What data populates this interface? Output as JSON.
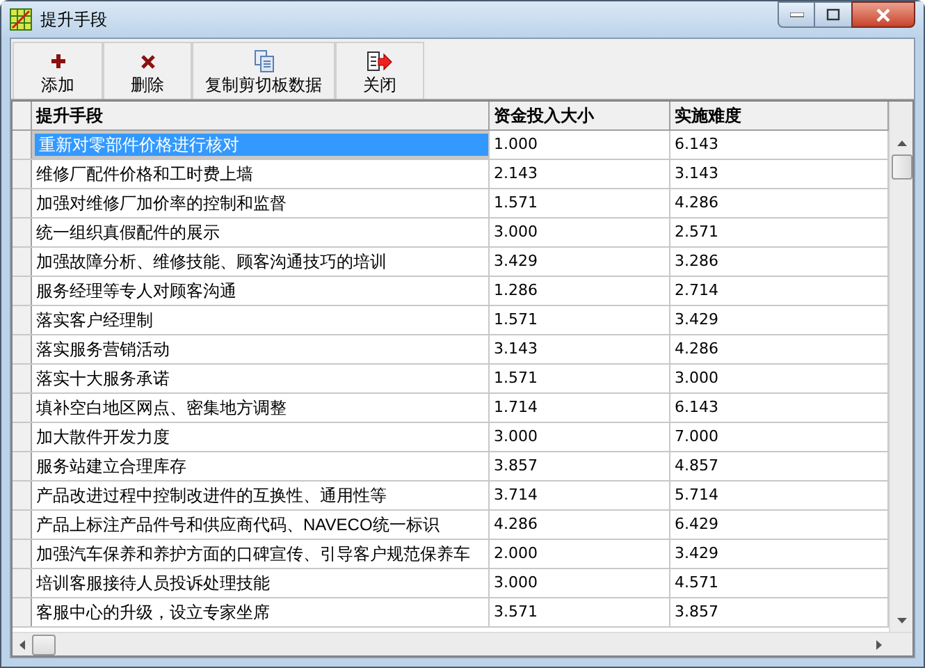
{
  "window": {
    "title": "提升手段"
  },
  "toolbar": [
    {
      "kind": "add",
      "label": "添加"
    },
    {
      "kind": "delete",
      "label": "删除"
    },
    {
      "kind": "copy",
      "label": "复制剪切板数据"
    },
    {
      "kind": "close",
      "label": "关闭"
    }
  ],
  "table": {
    "columns": [
      "提升手段",
      "资金投入大小",
      "实施难度"
    ],
    "rows": [
      {
        "cells": [
          "重新对零部件价格进行核对",
          "1.000",
          "6.143"
        ],
        "selected": true
      },
      {
        "cells": [
          "维修厂配件价格和工时费上墙",
          "2.143",
          "3.143"
        ],
        "selected": false
      },
      {
        "cells": [
          "加强对维修厂加价率的控制和监督",
          "1.571",
          "4.286"
        ],
        "selected": false
      },
      {
        "cells": [
          "统一组织真假配件的展示",
          "3.000",
          "2.571"
        ],
        "selected": false
      },
      {
        "cells": [
          "加强故障分析、维修技能、顾客沟通技巧的培训",
          "3.429",
          "3.286"
        ],
        "selected": false
      },
      {
        "cells": [
          "服务经理等专人对顾客沟通",
          "1.286",
          "2.714"
        ],
        "selected": false
      },
      {
        "cells": [
          "落实客户经理制",
          "1.571",
          "3.429"
        ],
        "selected": false
      },
      {
        "cells": [
          "落实服务营销活动",
          "3.143",
          "4.286"
        ],
        "selected": false
      },
      {
        "cells": [
          "落实十大服务承诺",
          "1.571",
          "3.000"
        ],
        "selected": false
      },
      {
        "cells": [
          "填补空白地区网点、密集地方调整",
          "1.714",
          "6.143"
        ],
        "selected": false
      },
      {
        "cells": [
          "加大散件开发力度",
          "3.000",
          "7.000"
        ],
        "selected": false
      },
      {
        "cells": [
          "服务站建立合理库存",
          "3.857",
          "4.857"
        ],
        "selected": false
      },
      {
        "cells": [
          "产品改进过程中控制改进件的互换性、通用性等",
          "3.714",
          "5.714"
        ],
        "selected": false
      },
      {
        "cells": [
          "产品上标注产品件号和供应商代码、NAVECO统一标识",
          "4.286",
          "6.429"
        ],
        "selected": false
      },
      {
        "cells": [
          "加强汽车保养和养护方面的口碑宣传、引导客户规范保养车",
          "2.000",
          "3.429"
        ],
        "selected": false
      },
      {
        "cells": [
          "培训客服接待人员投诉处理技能",
          "3.000",
          "4.571"
        ],
        "selected": false
      },
      {
        "cells": [
          "客服中心的升级，设立专家坐席",
          "3.571",
          "3.857"
        ],
        "selected": false
      }
    ]
  }
}
